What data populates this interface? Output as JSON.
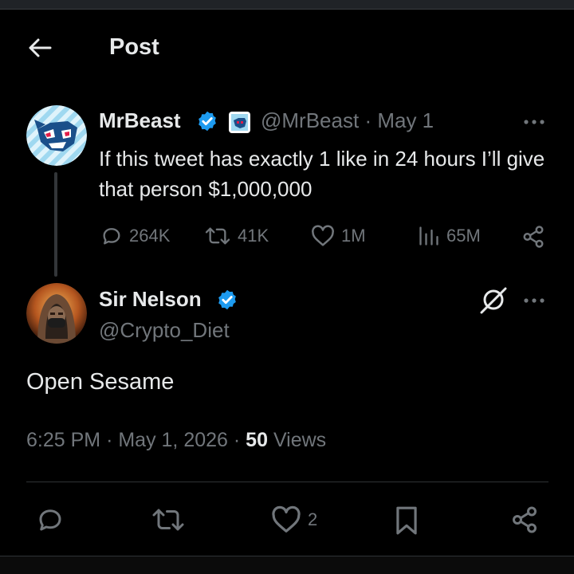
{
  "header": {
    "title": "Post"
  },
  "quoted_post": {
    "name": "MrBeast",
    "handle": "@MrBeast",
    "separator": "·",
    "date": "May 1",
    "text": "If this tweet has exactly 1 like in 24 hours I’ll give that person $1,000,000",
    "stats": {
      "replies": "264K",
      "reposts": "41K",
      "likes": "1M",
      "views": "65M"
    }
  },
  "reply_post": {
    "name": "Sir Nelson",
    "handle": "@Crypto_Diet",
    "text": "Open Sesame",
    "time": "6:25 PM",
    "date": "May 1, 2026",
    "separator": "·",
    "views_count": "50",
    "views_label": "Views",
    "likes": "2"
  },
  "icons": {
    "back": "arrow-left-icon",
    "verified": "verified-badge-icon",
    "affiliate": "affiliate-badge-icon",
    "more": "more-horizontal-icon",
    "reply": "reply-icon",
    "repost": "repost-icon",
    "like": "heart-icon",
    "views": "views-bar-icon",
    "share": "share-icon",
    "grok": "grok-icon",
    "bookmark": "bookmark-icon"
  },
  "colors": {
    "background": "#000000",
    "text": "#e7e9ea",
    "muted": "#71767b",
    "verified": "#1d9bf0",
    "divider": "#2f3336"
  }
}
